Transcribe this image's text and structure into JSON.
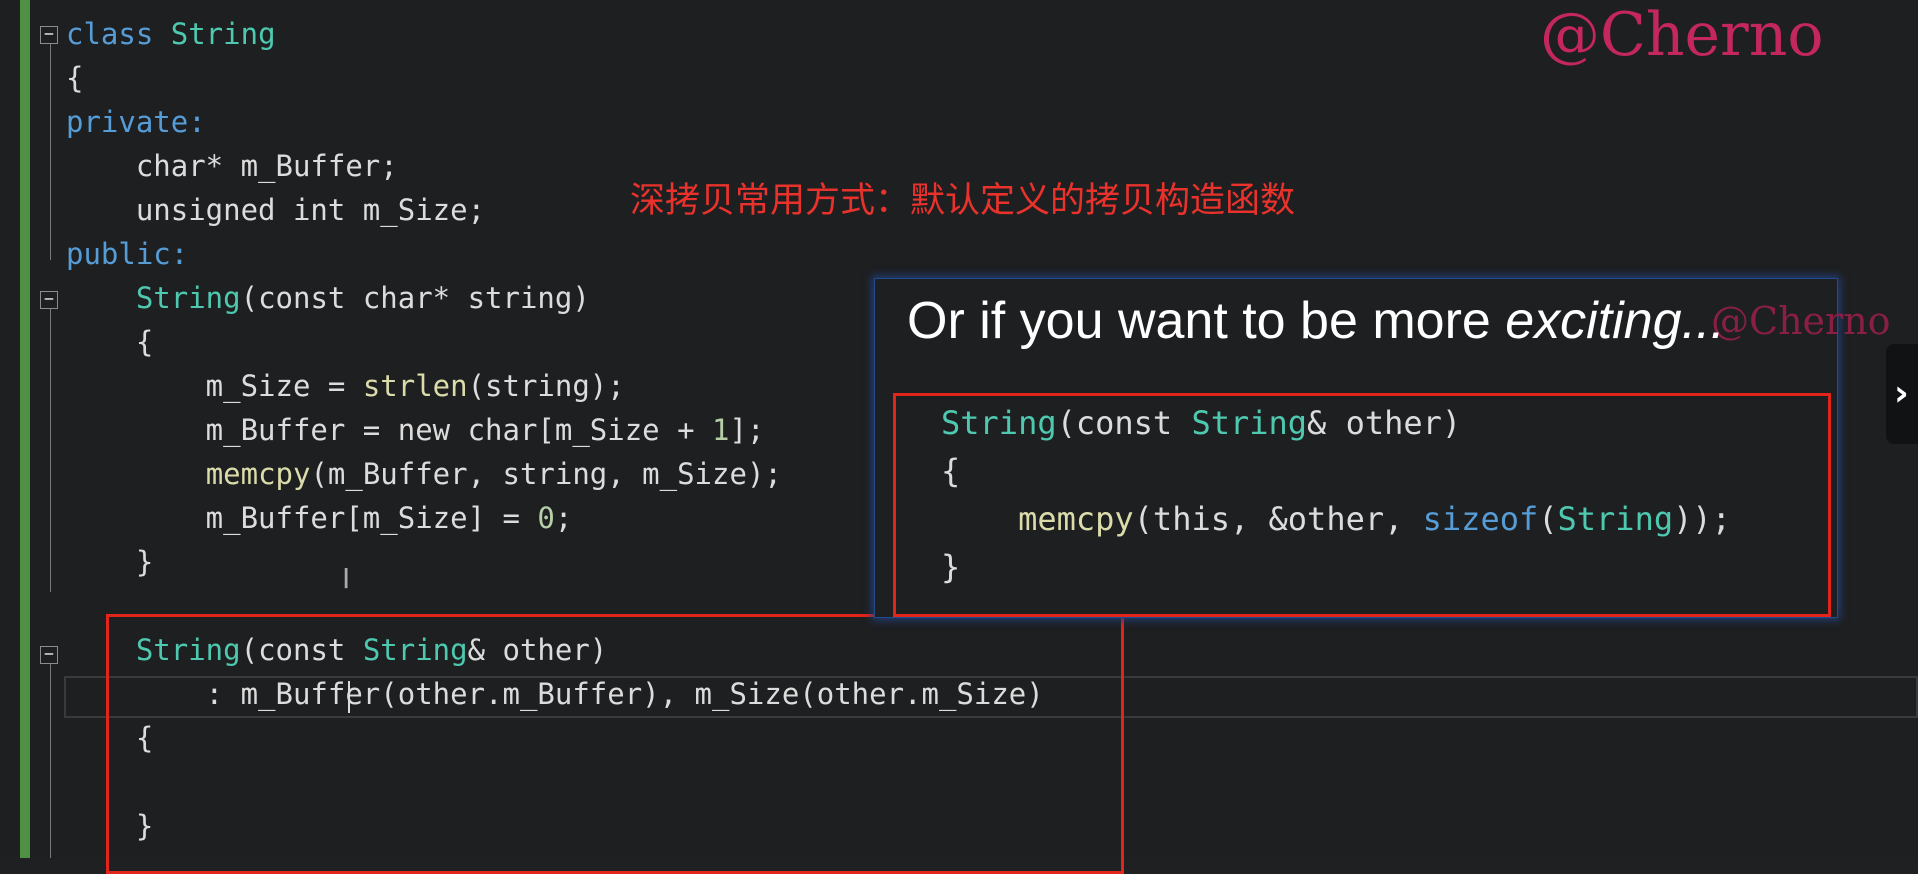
{
  "watermark": "@Cherno",
  "annotation": "深拷贝常用方式：默认定义的拷贝构造函数",
  "code": {
    "l1_a": "class ",
    "l1_b": "String",
    "l2": "{",
    "l3": "private:",
    "l4": "    char* m_Buffer;",
    "l5": "    unsigned int m_Size;",
    "l6": "public:",
    "l7_a": "    String",
    "l7_b": "(const char* string)",
    "l8": "    {",
    "l9_a": "        m_Size = ",
    "l9_b": "strlen",
    "l9_c": "(string);",
    "l10_a": "        m_Buffer = new char[m_Size + ",
    "l10_b": "1",
    "l10_c": "];",
    "l11_a": "        ",
    "l11_b": "memcpy",
    "l11_c": "(m_Buffer, string, m_Size);",
    "l12_a": "        m_Buffer[m_Size] = ",
    "l12_b": "0",
    "l12_c": ";",
    "l13": "    }",
    "l14": "",
    "l15_a": "    String",
    "l15_b": "(const ",
    "l15_c": "String",
    "l15_d": "& other)",
    "l16": "        : m_Buffer(other.m_Buffer), m_Size(other.m_Size)",
    "l17": "    {",
    "l18": "",
    "l19": "    }"
  },
  "overlay": {
    "title_plain": "Or if you want to be more ",
    "title_italic": "exciting...",
    "ghost_watermark": "@Cherno",
    "o1_a": "String",
    "o1_b": "(const ",
    "o1_c": "String",
    "o1_d": "& other)",
    "o2": "{",
    "o3_a": "    ",
    "o3_b": "memcpy",
    "o3_c": "(this, &other, ",
    "o3_d": "sizeof",
    "o3_e": "(",
    "o3_f": "String",
    "o3_g": "));",
    "o4": "}"
  },
  "side_tab_icon": "chevron-right-icon",
  "side_tab_glyph": "›",
  "ibeam_glyph": "I",
  "colors": {
    "annotation": "#e8322b",
    "highlight_box": "#e1251b",
    "watermark": "#c4265e"
  }
}
